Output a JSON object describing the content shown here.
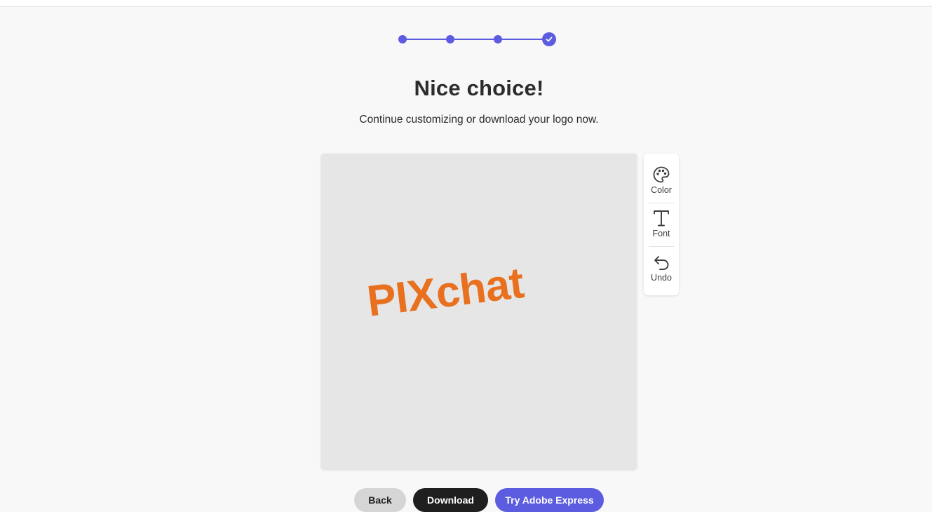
{
  "stepper": {
    "total_steps": 4,
    "current_step": 4,
    "accent_color": "#5c5ce0",
    "complete_icon": "check-icon"
  },
  "heading": {
    "title": "Nice choice!",
    "subtitle": "Continue customizing or download your logo now."
  },
  "preview": {
    "logo_text": "PIXchat",
    "logo_color": "#e8701f",
    "background_color": "#e6e6e6"
  },
  "tools": [
    {
      "label": "Color",
      "icon": "palette-icon"
    },
    {
      "label": "Font",
      "icon": "text-icon"
    },
    {
      "label": "Undo",
      "icon": "undo-icon"
    }
  ],
  "actions": {
    "back_label": "Back",
    "download_label": "Download",
    "express_label": "Try Adobe Express"
  }
}
